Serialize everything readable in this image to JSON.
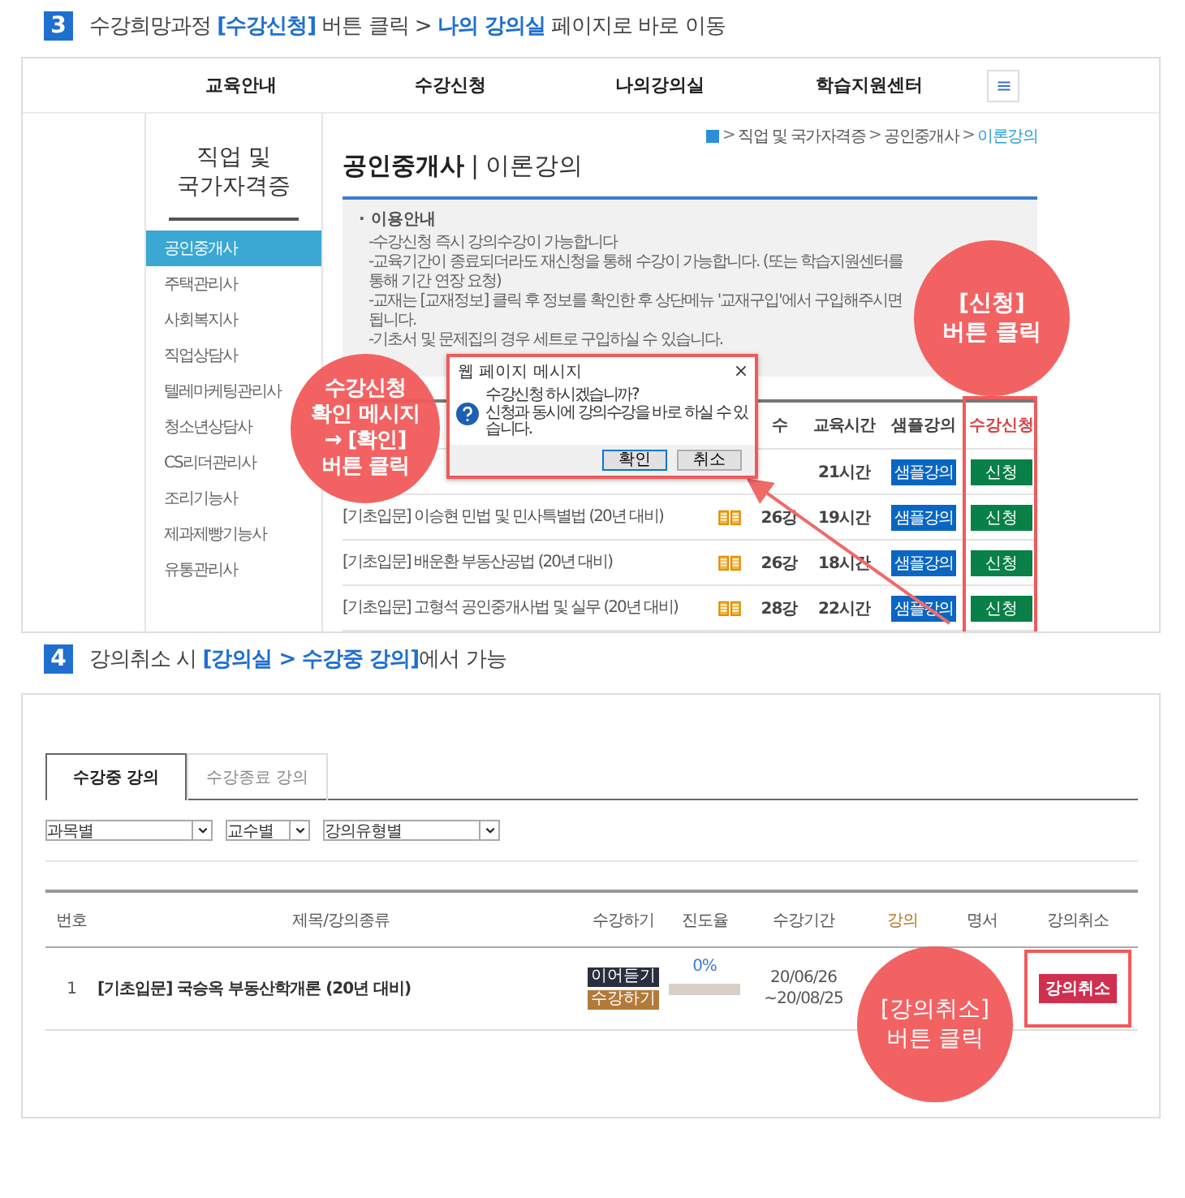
{
  "step3": {
    "number": "3",
    "heading": "수강희망과정 **[수강신청]** 버튼 클릭 > **나의 강의실** 페이지로 바로 이동"
  },
  "site": {
    "nav": [
      {
        "label": "교육안내"
      },
      {
        "label": "수강신청"
      },
      {
        "label": "나의강의실"
      },
      {
        "label": "학습지원센터"
      }
    ],
    "breadcrumb": [
      {
        "separator": ">",
        "label": "직업 및 국가자격증",
        "current": false
      },
      {
        "separator": ">",
        "label": "공인중개사",
        "current": false
      },
      {
        "separator": ">",
        "label": "이론강의",
        "current": true
      }
    ],
    "sidebar": {
      "title": "직업 및 국가자격증",
      "items": [
        {
          "label": "공인중개사",
          "selected": true
        },
        {
          "label": "주택관리사",
          "selected": false
        },
        {
          "label": "사회복지사",
          "selected": false
        },
        {
          "label": "직업상담사",
          "selected": false
        },
        {
          "label": "텔레마케팅관리사",
          "selected": false
        },
        {
          "label": "청소년상담사",
          "selected": false
        },
        {
          "label": "CS리더관리사",
          "selected": false
        },
        {
          "label": "조리기능사",
          "selected": false
        },
        {
          "label": "제과제빵기능사",
          "selected": false
        },
        {
          "label": "유통관리사",
          "selected": false
        }
      ]
    },
    "page_title": {
      "subject": "공인중개사",
      "divider": "|",
      "section": "이론강의"
    },
    "notice": {
      "title": "· 이용안내",
      "lines": [
        "-수강신청 즉시 강의수강이 가능합니다",
        "-교육기간이 종료되더라도 재신청을 통해 수강이 가능합니다. (또는 학습지원센터를 통해 기간 연장 요청)",
        "-교재는 [교재정보] 클릭 후 정보를 확인한 후 상단메뉴 '교재구입'에서 구입해주시면 됩니다.",
        "-기초서 및 문제집의 경우 세트로 구입하실 수 있습니다."
      ]
    },
    "table": {
      "columns": [
        "수",
        "교육시간",
        "샘플강의",
        "수강신청"
      ],
      "rows": [
        {
          "time": "21시간",
          "sample": "샘플강의",
          "apply": "신청"
        },
        {
          "book": true,
          "title": "[기초입문] 이승현 민법 및 민사특별법 (20년 대비)",
          "count": "26강",
          "time": "19시간",
          "sample": "샘플강의",
          "apply": "신청"
        },
        {
          "book": true,
          "title": "[기초입문] 배운환 부동산공법 (20년 대비)",
          "count": "26강",
          "time": "18시간",
          "sample": "샘플강의",
          "apply": "신청"
        },
        {
          "book": true,
          "title": "[기초입문] 고형석 공인중개사법 및 실무 (20년 대비)",
          "count": "28강",
          "time": "22시간",
          "sample": "샘플강의",
          "apply": "신청"
        }
      ]
    },
    "dialog": {
      "title": "웹 페이지 메시지",
      "message": [
        "수강신청 하시겠습니까?",
        "신청과 동시에 강의수강을 바로 하실 수 있습니다."
      ],
      "buttons": [
        "확인",
        "취소"
      ]
    },
    "callouts": [
      [
        "수강신청",
        "확인 메시지",
        "→ [확인]",
        "버튼 클릭"
      ],
      [
        "[신청]",
        "버튼 클릭"
      ]
    ]
  },
  "step4": {
    "number": "4",
    "heading": "강의취소 시 **[강의실 > 수강중 강의]**에서 가능"
  },
  "classroom": {
    "tabs": [
      {
        "label": "수강중 강의",
        "selected": true
      },
      {
        "label": "수강종료 강의",
        "selected": false
      }
    ],
    "filters": [
      "과목별",
      "교수별",
      "강의유형별"
    ],
    "columns": [
      "번호",
      "제목/강의종류",
      "수강하기",
      "진도율",
      "수강기간",
      "강의",
      "명서",
      "강의취소"
    ],
    "rows": [
      {
        "number": "1",
        "title": "[기초입문] 국승옥 부동산학개론 (20년 대비)",
        "actions": [
          {
            "label": "이어듣기",
            "kind": "resume"
          },
          {
            "label": "수강하기",
            "kind": "start"
          }
        ],
        "progress": "0%",
        "level": 0,
        "period": [
          "20/06/26",
          "~20/08/25"
        ],
        "cancel": "강의취소"
      }
    ],
    "callout": [
      "[강의취소]",
      "버튼 클릭"
    ]
  }
}
